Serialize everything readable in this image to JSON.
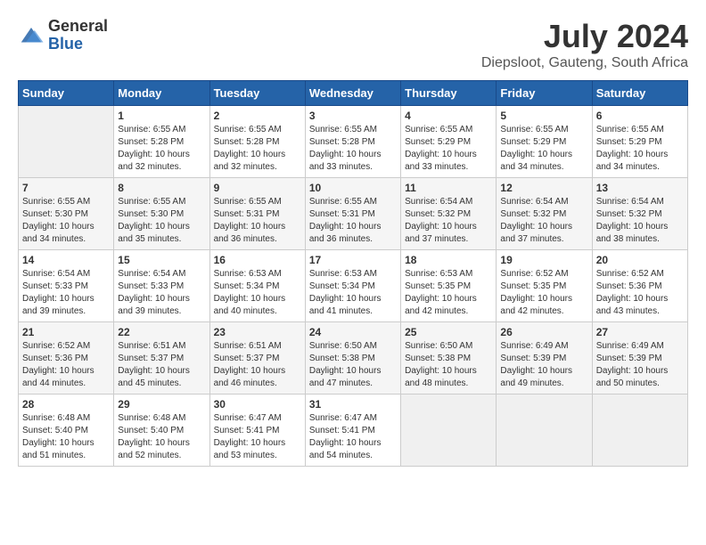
{
  "header": {
    "logo": {
      "general": "General",
      "blue": "Blue"
    },
    "title": "July 2024",
    "location": "Diepsloot, Gauteng, South Africa"
  },
  "calendar": {
    "days_of_week": [
      "Sunday",
      "Monday",
      "Tuesday",
      "Wednesday",
      "Thursday",
      "Friday",
      "Saturday"
    ],
    "weeks": [
      [
        {
          "day": "",
          "sunrise": "",
          "sunset": "",
          "daylight": "",
          "empty": true
        },
        {
          "day": "1",
          "sunrise": "Sunrise: 6:55 AM",
          "sunset": "Sunset: 5:28 PM",
          "daylight": "Daylight: 10 hours and 32 minutes."
        },
        {
          "day": "2",
          "sunrise": "Sunrise: 6:55 AM",
          "sunset": "Sunset: 5:28 PM",
          "daylight": "Daylight: 10 hours and 32 minutes."
        },
        {
          "day": "3",
          "sunrise": "Sunrise: 6:55 AM",
          "sunset": "Sunset: 5:28 PM",
          "daylight": "Daylight: 10 hours and 33 minutes."
        },
        {
          "day": "4",
          "sunrise": "Sunrise: 6:55 AM",
          "sunset": "Sunset: 5:29 PM",
          "daylight": "Daylight: 10 hours and 33 minutes."
        },
        {
          "day": "5",
          "sunrise": "Sunrise: 6:55 AM",
          "sunset": "Sunset: 5:29 PM",
          "daylight": "Daylight: 10 hours and 34 minutes."
        },
        {
          "day": "6",
          "sunrise": "Sunrise: 6:55 AM",
          "sunset": "Sunset: 5:29 PM",
          "daylight": "Daylight: 10 hours and 34 minutes."
        }
      ],
      [
        {
          "day": "7",
          "sunrise": "Sunrise: 6:55 AM",
          "sunset": "Sunset: 5:30 PM",
          "daylight": "Daylight: 10 hours and 34 minutes."
        },
        {
          "day": "8",
          "sunrise": "Sunrise: 6:55 AM",
          "sunset": "Sunset: 5:30 PM",
          "daylight": "Daylight: 10 hours and 35 minutes."
        },
        {
          "day": "9",
          "sunrise": "Sunrise: 6:55 AM",
          "sunset": "Sunset: 5:31 PM",
          "daylight": "Daylight: 10 hours and 36 minutes."
        },
        {
          "day": "10",
          "sunrise": "Sunrise: 6:55 AM",
          "sunset": "Sunset: 5:31 PM",
          "daylight": "Daylight: 10 hours and 36 minutes."
        },
        {
          "day": "11",
          "sunrise": "Sunrise: 6:54 AM",
          "sunset": "Sunset: 5:32 PM",
          "daylight": "Daylight: 10 hours and 37 minutes."
        },
        {
          "day": "12",
          "sunrise": "Sunrise: 6:54 AM",
          "sunset": "Sunset: 5:32 PM",
          "daylight": "Daylight: 10 hours and 37 minutes."
        },
        {
          "day": "13",
          "sunrise": "Sunrise: 6:54 AM",
          "sunset": "Sunset: 5:32 PM",
          "daylight": "Daylight: 10 hours and 38 minutes."
        }
      ],
      [
        {
          "day": "14",
          "sunrise": "Sunrise: 6:54 AM",
          "sunset": "Sunset: 5:33 PM",
          "daylight": "Daylight: 10 hours and 39 minutes."
        },
        {
          "day": "15",
          "sunrise": "Sunrise: 6:54 AM",
          "sunset": "Sunset: 5:33 PM",
          "daylight": "Daylight: 10 hours and 39 minutes."
        },
        {
          "day": "16",
          "sunrise": "Sunrise: 6:53 AM",
          "sunset": "Sunset: 5:34 PM",
          "daylight": "Daylight: 10 hours and 40 minutes."
        },
        {
          "day": "17",
          "sunrise": "Sunrise: 6:53 AM",
          "sunset": "Sunset: 5:34 PM",
          "daylight": "Daylight: 10 hours and 41 minutes."
        },
        {
          "day": "18",
          "sunrise": "Sunrise: 6:53 AM",
          "sunset": "Sunset: 5:35 PM",
          "daylight": "Daylight: 10 hours and 42 minutes."
        },
        {
          "day": "19",
          "sunrise": "Sunrise: 6:52 AM",
          "sunset": "Sunset: 5:35 PM",
          "daylight": "Daylight: 10 hours and 42 minutes."
        },
        {
          "day": "20",
          "sunrise": "Sunrise: 6:52 AM",
          "sunset": "Sunset: 5:36 PM",
          "daylight": "Daylight: 10 hours and 43 minutes."
        }
      ],
      [
        {
          "day": "21",
          "sunrise": "Sunrise: 6:52 AM",
          "sunset": "Sunset: 5:36 PM",
          "daylight": "Daylight: 10 hours and 44 minutes."
        },
        {
          "day": "22",
          "sunrise": "Sunrise: 6:51 AM",
          "sunset": "Sunset: 5:37 PM",
          "daylight": "Daylight: 10 hours and 45 minutes."
        },
        {
          "day": "23",
          "sunrise": "Sunrise: 6:51 AM",
          "sunset": "Sunset: 5:37 PM",
          "daylight": "Daylight: 10 hours and 46 minutes."
        },
        {
          "day": "24",
          "sunrise": "Sunrise: 6:50 AM",
          "sunset": "Sunset: 5:38 PM",
          "daylight": "Daylight: 10 hours and 47 minutes."
        },
        {
          "day": "25",
          "sunrise": "Sunrise: 6:50 AM",
          "sunset": "Sunset: 5:38 PM",
          "daylight": "Daylight: 10 hours and 48 minutes."
        },
        {
          "day": "26",
          "sunrise": "Sunrise: 6:49 AM",
          "sunset": "Sunset: 5:39 PM",
          "daylight": "Daylight: 10 hours and 49 minutes."
        },
        {
          "day": "27",
          "sunrise": "Sunrise: 6:49 AM",
          "sunset": "Sunset: 5:39 PM",
          "daylight": "Daylight: 10 hours and 50 minutes."
        }
      ],
      [
        {
          "day": "28",
          "sunrise": "Sunrise: 6:48 AM",
          "sunset": "Sunset: 5:40 PM",
          "daylight": "Daylight: 10 hours and 51 minutes."
        },
        {
          "day": "29",
          "sunrise": "Sunrise: 6:48 AM",
          "sunset": "Sunset: 5:40 PM",
          "daylight": "Daylight: 10 hours and 52 minutes."
        },
        {
          "day": "30",
          "sunrise": "Sunrise: 6:47 AM",
          "sunset": "Sunset: 5:41 PM",
          "daylight": "Daylight: 10 hours and 53 minutes."
        },
        {
          "day": "31",
          "sunrise": "Sunrise: 6:47 AM",
          "sunset": "Sunset: 5:41 PM",
          "daylight": "Daylight: 10 hours and 54 minutes."
        },
        {
          "day": "",
          "sunrise": "",
          "sunset": "",
          "daylight": "",
          "empty": true
        },
        {
          "day": "",
          "sunrise": "",
          "sunset": "",
          "daylight": "",
          "empty": true
        },
        {
          "day": "",
          "sunrise": "",
          "sunset": "",
          "daylight": "",
          "empty": true
        }
      ]
    ]
  }
}
